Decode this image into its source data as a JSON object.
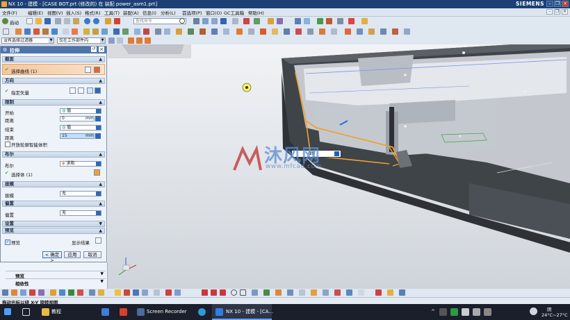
{
  "window": {
    "title": "NX 10 - 建模 - [CASE BOT.prt  (修改的)   在 装配 power_asm1.prt]",
    "brand": "SIEMENS"
  },
  "menu": [
    "文件(F)",
    "编辑(E)",
    "视图(V)",
    "插入(S)",
    "格式(R)",
    "工具(T)",
    "装配(A)",
    "信息(I)",
    "分析(L)",
    "首选项(P)",
    "窗口(O)",
    "GC工具箱",
    "帮助(H)"
  ],
  "toolbar": {
    "start_label": "启动",
    "search_placeholder": "查找命令",
    "filter_value": "没有选择过滤器",
    "scope_value": "仅在工作部件内"
  },
  "dialog": {
    "title": "拉伸",
    "sections": {
      "section": "截面",
      "direction": "方向",
      "limits": "限制",
      "boolean": "布尔",
      "draft": "拔模",
      "offset": "偏置",
      "settings": "设置",
      "preview": "预览"
    },
    "select_curve": "选择曲线 (1)",
    "specify_vector": "指定矢量",
    "start_label": "开始",
    "start_value": "值",
    "distance_label": "距离",
    "start_distance": "0",
    "end_label": "结束",
    "end_value": "值",
    "end_distance": "15",
    "unit": "mm",
    "open_profile": "开放轮廓智能体积",
    "boolean_label": "布尔",
    "boolean_value": "求和",
    "select_body": "选择体 (1)",
    "draft_label": "拔模",
    "draft_value": "无",
    "offset_label": "偏置",
    "offset_value": "无",
    "preview_label": "预览",
    "show_result": "显示结果",
    "ok": "< 确定 >",
    "apply": "应用",
    "cancel": "取消"
  },
  "lower_panel": {
    "item1": "预览",
    "item2": "相依性"
  },
  "status": "拖动光标以绕 X-Y 旋转视图",
  "viewport": {
    "handle_value": "15",
    "watermark_cn": "沐风网",
    "watermark_url": "www.mfcad.com"
  },
  "taskbar": {
    "folder": "教程",
    "screen_recorder": "Screen Recorder",
    "nx": "NX 10 - 建模 - [CA...",
    "weather_text": "阴",
    "temp": "24°C~27°C"
  },
  "colors": {
    "titlebar": "#1c3f75",
    "dialog_header": "#4e74a8",
    "selection_orange": "#f0a030",
    "taskbar": "#1b1f2b"
  }
}
